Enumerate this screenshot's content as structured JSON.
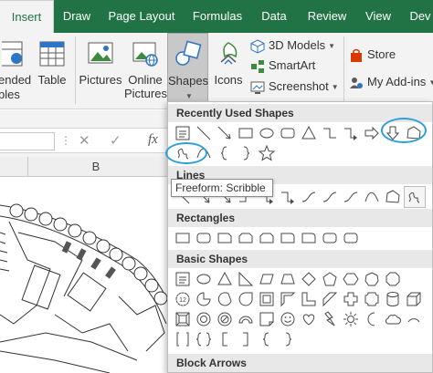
{
  "tabs": [
    "Insert",
    "Draw",
    "Page Layout",
    "Formulas",
    "Data",
    "Review",
    "View",
    "Dev"
  ],
  "ribbon": {
    "partial_label_1": "ended",
    "partial_label_2": "bles",
    "table": "Table",
    "pictures": "Pictures",
    "online_line1": "Online",
    "online_line2": "Pictures",
    "shapes": "Shapes",
    "icons": "Icons",
    "models_3d": "3D Models",
    "smartart": "SmartArt",
    "screenshot": "Screenshot",
    "store": "Store",
    "my_addins": "My Add-ins"
  },
  "formula_bar": {
    "cancel": "✕",
    "enter": "✓",
    "fx": "fx"
  },
  "column_header": "B",
  "dropdown": {
    "recently_used": "Recently Used Shapes",
    "lines": "Lines",
    "rectangles": "Rectangles",
    "basic_shapes": "Basic Shapes",
    "block_arrows": "Block Arrows"
  },
  "tooltip": "Freeform: Scribble",
  "colors": {
    "accent": "#217346",
    "highlight": "#2f9fd8"
  }
}
